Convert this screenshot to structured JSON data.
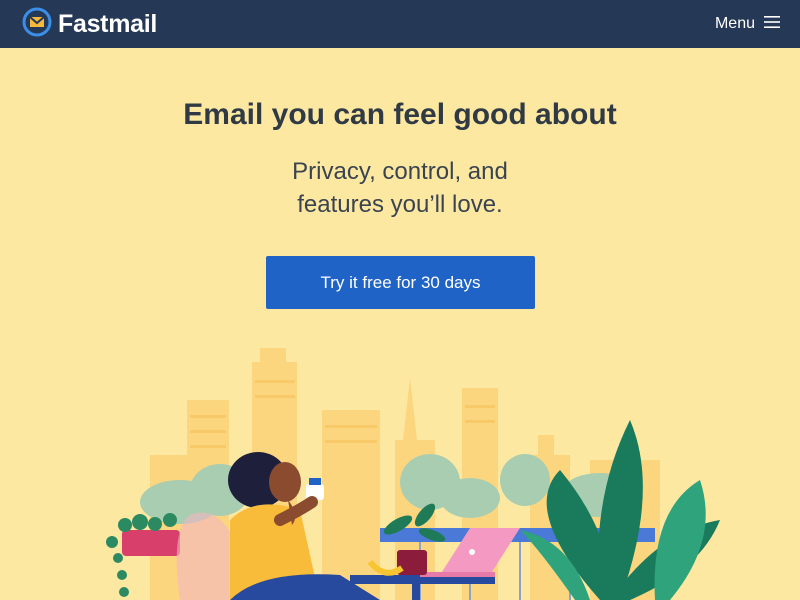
{
  "header": {
    "brand_name": "Fastmail",
    "menu_label": "Menu"
  },
  "hero": {
    "headline": "Email you can feel good about",
    "subline_1": "Privacy, control, and",
    "subline_2": "features you’ll love.",
    "cta_label": "Try it free for 30 days"
  },
  "colors": {
    "header_bg": "#253855",
    "page_bg": "#fde8a2",
    "cta_bg": "#1f63c6",
    "text": "#2f3a45"
  }
}
